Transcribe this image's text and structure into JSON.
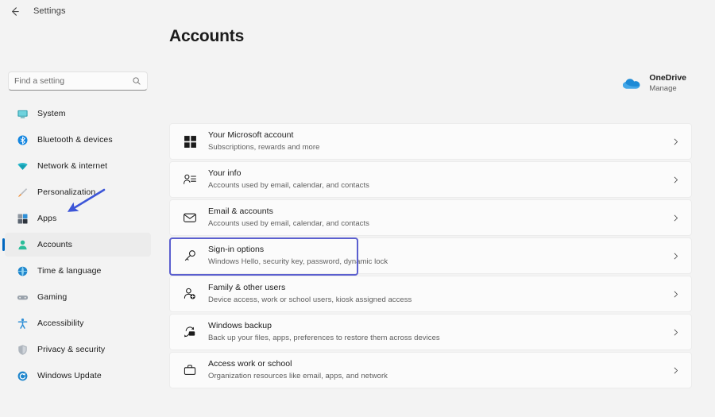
{
  "window": {
    "title": "Settings",
    "back_icon": "back-arrow-icon"
  },
  "search": {
    "placeholder": "Find a setting",
    "value": "",
    "icon": "search-icon"
  },
  "sidebar": {
    "items": [
      {
        "label": "System",
        "icon": "monitor-icon",
        "selected": false
      },
      {
        "label": "Bluetooth & devices",
        "icon": "bluetooth-icon",
        "selected": false
      },
      {
        "label": "Network & internet",
        "icon": "wifi-icon",
        "selected": false
      },
      {
        "label": "Personalization",
        "icon": "paintbrush-icon",
        "selected": false
      },
      {
        "label": "Apps",
        "icon": "apps-grid-icon",
        "selected": false
      },
      {
        "label": "Accounts",
        "icon": "person-icon",
        "selected": true
      },
      {
        "label": "Time & language",
        "icon": "globe-clock-icon",
        "selected": false
      },
      {
        "label": "Gaming",
        "icon": "gamepad-icon",
        "selected": false
      },
      {
        "label": "Accessibility",
        "icon": "accessibility-icon",
        "selected": false
      },
      {
        "label": "Privacy & security",
        "icon": "shield-icon",
        "selected": false
      },
      {
        "label": "Windows Update",
        "icon": "update-refresh-icon",
        "selected": false
      }
    ]
  },
  "page": {
    "title": "Accounts"
  },
  "onedrive": {
    "name": "OneDrive",
    "action": "Manage",
    "icon": "onedrive-cloud-icon"
  },
  "cards": [
    {
      "title": "Your Microsoft account",
      "subtitle": "Subscriptions, rewards and more",
      "icon": "microsoft-logo-icon",
      "focused": false
    },
    {
      "title": "Your info",
      "subtitle": "Accounts used by email, calendar, and contacts",
      "icon": "user-info-icon",
      "focused": false
    },
    {
      "title": "Email & accounts",
      "subtitle": "Accounts used by email, calendar, and contacts",
      "icon": "envelope-icon",
      "focused": false
    },
    {
      "title": "Sign-in options",
      "subtitle": "Windows Hello, security key, password, dynamic lock",
      "icon": "key-icon",
      "focused": true
    },
    {
      "title": "Family & other users",
      "subtitle": "Device access, work or school users, kiosk assigned access",
      "icon": "person-add-icon",
      "focused": false
    },
    {
      "title": "Windows backup",
      "subtitle": "Back up your files, apps, preferences to restore them across devices",
      "icon": "backup-sync-icon",
      "focused": false
    },
    {
      "title": "Access work or school",
      "subtitle": "Organization resources like email, apps, and network",
      "icon": "briefcase-icon",
      "focused": false
    }
  ],
  "annotation": {
    "type": "arrow",
    "points_to": "sidebar-item-accounts",
    "color": "#3d56d8"
  },
  "colors": {
    "page_background": "#f3f3f3",
    "card_background": "#fbfbfb",
    "accent": "#0067c0",
    "focus_ring": "#5b5fcf",
    "annotation": "#3d56d8"
  }
}
